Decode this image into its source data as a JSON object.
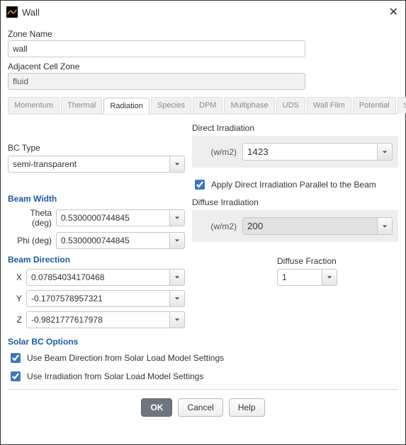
{
  "window": {
    "title": "Wall"
  },
  "zone": {
    "name_label": "Zone Name",
    "name_value": "wall",
    "adjacent_label": "Adjacent Cell Zone",
    "adjacent_value": "fluid"
  },
  "tabs": [
    "Momentum",
    "Thermal",
    "Radiation",
    "Species",
    "DPM",
    "Multiphase",
    "UDS",
    "Wall Film",
    "Potential",
    "Structure"
  ],
  "active_tab": "Radiation",
  "bc_type": {
    "label": "BC Type",
    "value": "semi-transparent"
  },
  "direct_irradiation": {
    "title": "Direct Irradiation",
    "units": "(w/m2)",
    "value": "1423",
    "apply_beam_label": "Apply Direct Irradiation Parallel to the Beam",
    "apply_beam_checked": true
  },
  "diffuse_irradiation": {
    "title": "Diffuse Irradiation",
    "units": "(w/m2)",
    "value": "200"
  },
  "beam_width": {
    "title": "Beam Width",
    "theta_label": "Theta (deg)",
    "theta_value": "0.5300000744845",
    "phi_label": "Phi (deg)",
    "phi_value": "0.5300000744845"
  },
  "beam_direction": {
    "title": "Beam Direction",
    "x_label": "X",
    "x_value": "0.07854034170468",
    "y_label": "Y",
    "y_value": "-0.1707578957321",
    "z_label": "Z",
    "z_value": "-0.9821777617978"
  },
  "diffuse_fraction": {
    "title": "Diffuse Fraction",
    "value": "1"
  },
  "solar_bc": {
    "title": "Solar BC Options",
    "opt1_label": "Use Beam Direction from Solar Load Model Settings",
    "opt1_checked": true,
    "opt2_label": "Use Irradiation from Solar Load Model Settings",
    "opt2_checked": true
  },
  "buttons": {
    "ok": "OK",
    "cancel": "Cancel",
    "help": "Help"
  }
}
